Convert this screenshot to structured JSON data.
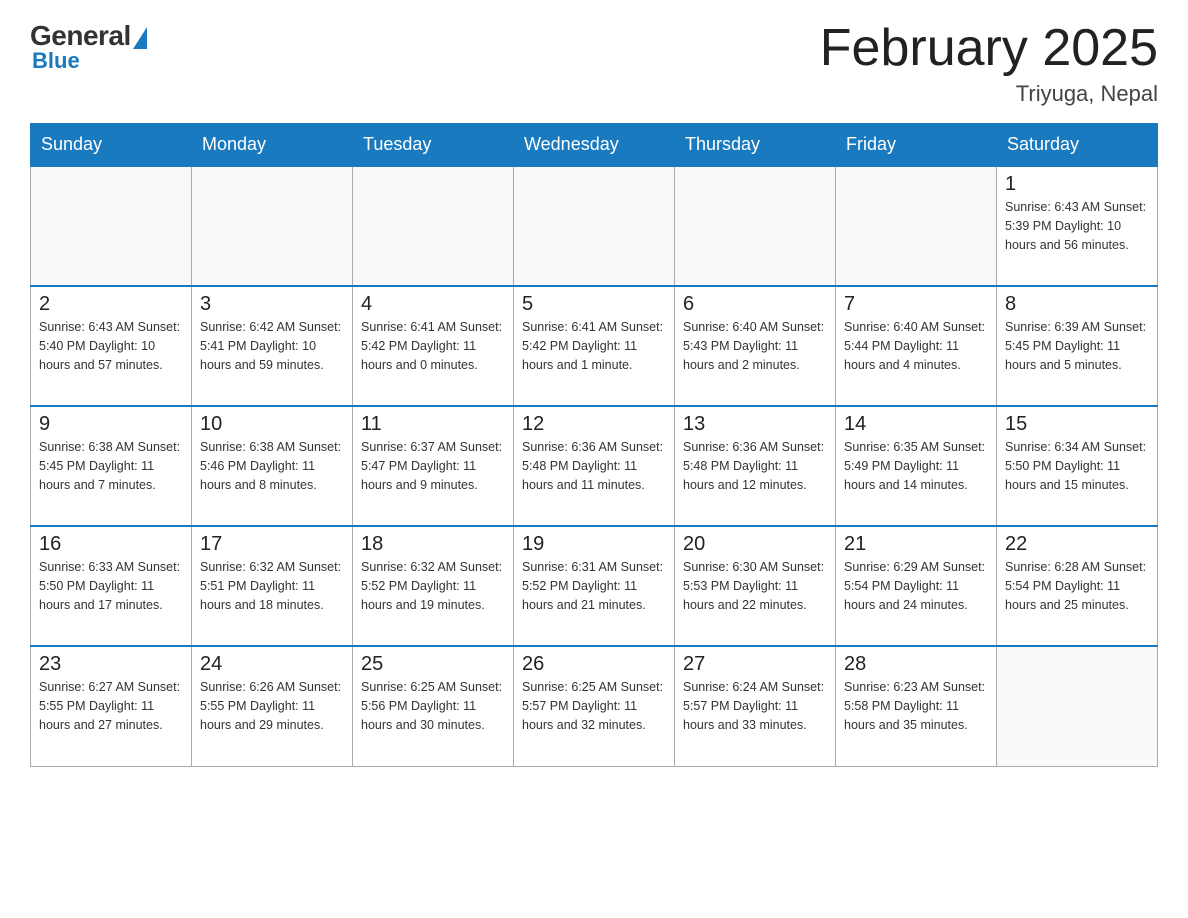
{
  "logo": {
    "general": "General",
    "blue": "Blue"
  },
  "header": {
    "month": "February 2025",
    "location": "Triyuga, Nepal"
  },
  "weekdays": [
    "Sunday",
    "Monday",
    "Tuesday",
    "Wednesday",
    "Thursday",
    "Friday",
    "Saturday"
  ],
  "weeks": [
    [
      {
        "day": "",
        "info": ""
      },
      {
        "day": "",
        "info": ""
      },
      {
        "day": "",
        "info": ""
      },
      {
        "day": "",
        "info": ""
      },
      {
        "day": "",
        "info": ""
      },
      {
        "day": "",
        "info": ""
      },
      {
        "day": "1",
        "info": "Sunrise: 6:43 AM\nSunset: 5:39 PM\nDaylight: 10 hours\nand 56 minutes."
      }
    ],
    [
      {
        "day": "2",
        "info": "Sunrise: 6:43 AM\nSunset: 5:40 PM\nDaylight: 10 hours\nand 57 minutes."
      },
      {
        "day": "3",
        "info": "Sunrise: 6:42 AM\nSunset: 5:41 PM\nDaylight: 10 hours\nand 59 minutes."
      },
      {
        "day": "4",
        "info": "Sunrise: 6:41 AM\nSunset: 5:42 PM\nDaylight: 11 hours\nand 0 minutes."
      },
      {
        "day": "5",
        "info": "Sunrise: 6:41 AM\nSunset: 5:42 PM\nDaylight: 11 hours\nand 1 minute."
      },
      {
        "day": "6",
        "info": "Sunrise: 6:40 AM\nSunset: 5:43 PM\nDaylight: 11 hours\nand 2 minutes."
      },
      {
        "day": "7",
        "info": "Sunrise: 6:40 AM\nSunset: 5:44 PM\nDaylight: 11 hours\nand 4 minutes."
      },
      {
        "day": "8",
        "info": "Sunrise: 6:39 AM\nSunset: 5:45 PM\nDaylight: 11 hours\nand 5 minutes."
      }
    ],
    [
      {
        "day": "9",
        "info": "Sunrise: 6:38 AM\nSunset: 5:45 PM\nDaylight: 11 hours\nand 7 minutes."
      },
      {
        "day": "10",
        "info": "Sunrise: 6:38 AM\nSunset: 5:46 PM\nDaylight: 11 hours\nand 8 minutes."
      },
      {
        "day": "11",
        "info": "Sunrise: 6:37 AM\nSunset: 5:47 PM\nDaylight: 11 hours\nand 9 minutes."
      },
      {
        "day": "12",
        "info": "Sunrise: 6:36 AM\nSunset: 5:48 PM\nDaylight: 11 hours\nand 11 minutes."
      },
      {
        "day": "13",
        "info": "Sunrise: 6:36 AM\nSunset: 5:48 PM\nDaylight: 11 hours\nand 12 minutes."
      },
      {
        "day": "14",
        "info": "Sunrise: 6:35 AM\nSunset: 5:49 PM\nDaylight: 11 hours\nand 14 minutes."
      },
      {
        "day": "15",
        "info": "Sunrise: 6:34 AM\nSunset: 5:50 PM\nDaylight: 11 hours\nand 15 minutes."
      }
    ],
    [
      {
        "day": "16",
        "info": "Sunrise: 6:33 AM\nSunset: 5:50 PM\nDaylight: 11 hours\nand 17 minutes."
      },
      {
        "day": "17",
        "info": "Sunrise: 6:32 AM\nSunset: 5:51 PM\nDaylight: 11 hours\nand 18 minutes."
      },
      {
        "day": "18",
        "info": "Sunrise: 6:32 AM\nSunset: 5:52 PM\nDaylight: 11 hours\nand 19 minutes."
      },
      {
        "day": "19",
        "info": "Sunrise: 6:31 AM\nSunset: 5:52 PM\nDaylight: 11 hours\nand 21 minutes."
      },
      {
        "day": "20",
        "info": "Sunrise: 6:30 AM\nSunset: 5:53 PM\nDaylight: 11 hours\nand 22 minutes."
      },
      {
        "day": "21",
        "info": "Sunrise: 6:29 AM\nSunset: 5:54 PM\nDaylight: 11 hours\nand 24 minutes."
      },
      {
        "day": "22",
        "info": "Sunrise: 6:28 AM\nSunset: 5:54 PM\nDaylight: 11 hours\nand 25 minutes."
      }
    ],
    [
      {
        "day": "23",
        "info": "Sunrise: 6:27 AM\nSunset: 5:55 PM\nDaylight: 11 hours\nand 27 minutes."
      },
      {
        "day": "24",
        "info": "Sunrise: 6:26 AM\nSunset: 5:55 PM\nDaylight: 11 hours\nand 29 minutes."
      },
      {
        "day": "25",
        "info": "Sunrise: 6:25 AM\nSunset: 5:56 PM\nDaylight: 11 hours\nand 30 minutes."
      },
      {
        "day": "26",
        "info": "Sunrise: 6:25 AM\nSunset: 5:57 PM\nDaylight: 11 hours\nand 32 minutes."
      },
      {
        "day": "27",
        "info": "Sunrise: 6:24 AM\nSunset: 5:57 PM\nDaylight: 11 hours\nand 33 minutes."
      },
      {
        "day": "28",
        "info": "Sunrise: 6:23 AM\nSunset: 5:58 PM\nDaylight: 11 hours\nand 35 minutes."
      },
      {
        "day": "",
        "info": ""
      }
    ]
  ]
}
